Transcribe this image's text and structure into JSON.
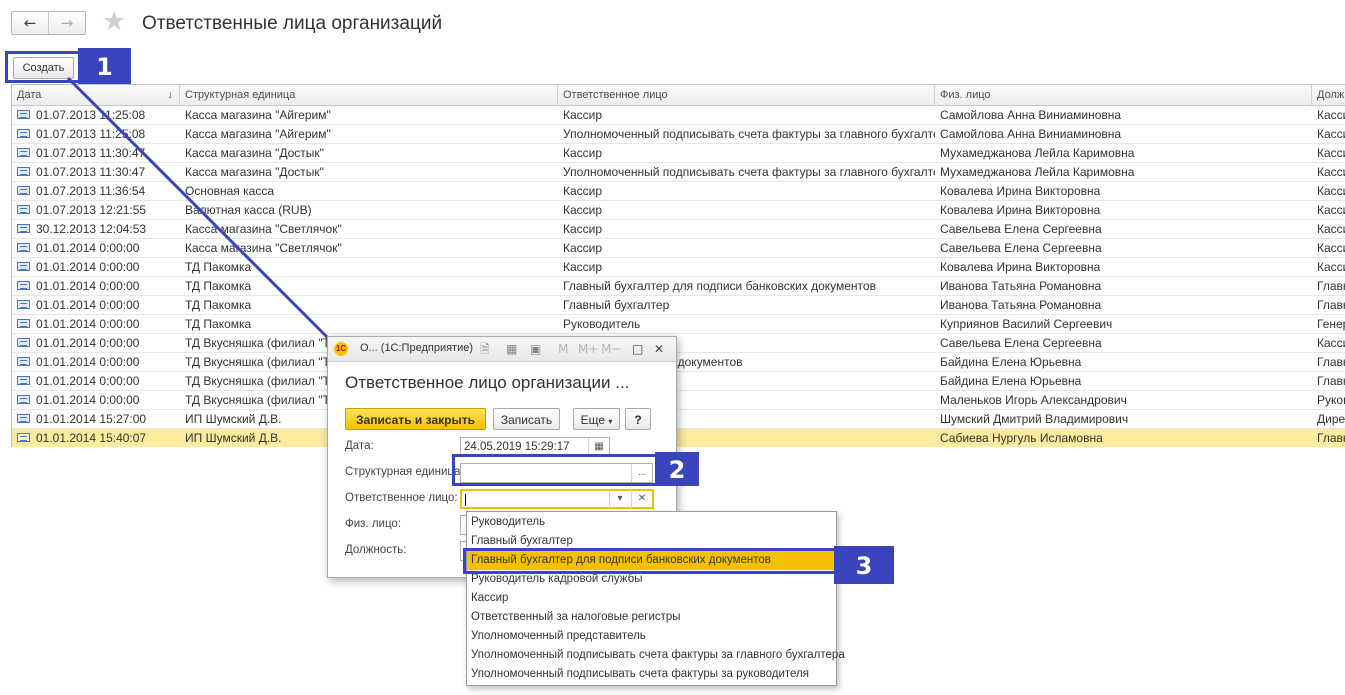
{
  "header": {
    "back_icon": "arrow-left-icon",
    "forward_icon": "arrow-right-icon",
    "favorite_icon": "star-icon",
    "title": "Ответственные лица организаций"
  },
  "toolbar": {
    "create_label": "Создать"
  },
  "callouts": {
    "c1": "1",
    "c2": "2",
    "c3": "3",
    "color": "#3a44bd"
  },
  "table": {
    "columns": [
      "Дата",
      "Структурная единица",
      "Ответственное лицо",
      "Физ. лицо",
      "Долж"
    ],
    "sort_icon": "↓",
    "rows": [
      {
        "date": "01.07.2013 11:25:08",
        "unit": "Касса магазина \"Айгерим\"",
        "role": "Кассир",
        "person": "Самойлова Анна Виниаминовна",
        "pos": "Касси"
      },
      {
        "date": "01.07.2013 11:25:08",
        "unit": "Касса магазина \"Айгерим\"",
        "role": "Уполномоченный подписывать счета фактуры за главного бухгалтера",
        "person": "Самойлова Анна Виниаминовна",
        "pos": "Касси"
      },
      {
        "date": "01.07.2013 11:30:47",
        "unit": "Касса магазина \"Достык\"",
        "role": "Кассир",
        "person": "Мухамеджанова Лейла Каримовна",
        "pos": "Касси"
      },
      {
        "date": "01.07.2013 11:30:47",
        "unit": "Касса магазина \"Достык\"",
        "role": "Уполномоченный подписывать счета фактуры за главного бухгалтера",
        "person": "Мухамеджанова Лейла Каримовна",
        "pos": "Касси"
      },
      {
        "date": "01.07.2013 11:36:54",
        "unit": "Основная касса",
        "role": "Кассир",
        "person": "Ковалева Ирина Викторовна",
        "pos": "Касси"
      },
      {
        "date": "01.07.2013 12:21:55",
        "unit": "Валютная касса (RUB)",
        "role": "Кассир",
        "person": "Ковалева Ирина Викторовна",
        "pos": "Касси"
      },
      {
        "date": "30.12.2013 12:04:53",
        "unit": "Касса магазина \"Светлячок\"",
        "role": "Кассир",
        "person": "Савельева Елена Сергеевна",
        "pos": "Касси"
      },
      {
        "date": "01.01.2014 0:00:00",
        "unit": "Касса магазина \"Светлячок\"",
        "role": "Кассир",
        "person": "Савельева Елена Сергеевна",
        "pos": "Касси"
      },
      {
        "date": "01.01.2014 0:00:00",
        "unit": "ТД Пакомка",
        "role": "Кассир",
        "person": "Ковалева Ирина Викторовна",
        "pos": "Касси"
      },
      {
        "date": "01.01.2014 0:00:00",
        "unit": "ТД Пакомка",
        "role": "Главный бухгалтер для подписи банковских документов",
        "person": "Иванова Татьяна Романовна",
        "pos": "Главн"
      },
      {
        "date": "01.01.2014 0:00:00",
        "unit": "ТД Пакомка",
        "role": "Главный бухгалтер",
        "person": "Иванова Татьяна Романовна",
        "pos": "Главн"
      },
      {
        "date": "01.01.2014 0:00:00",
        "unit": "ТД Пакомка",
        "role": "Руководитель",
        "person": "Куприянов Василий Сергеевич",
        "pos": "Генер"
      },
      {
        "date": "01.01.2014 0:00:00",
        "unit": "ТД Вкусняшка (филиал \"ТД",
        "role": "",
        "person": "Савельева Елена Сергеевна",
        "pos": "Касси"
      },
      {
        "date": "01.01.2014 0:00:00",
        "unit": "ТД Вкусняшка (филиал \"ТД",
        "role": "подписи банковских документов",
        "person": "Байдина Елена Юрьевна",
        "pos": "Главн"
      },
      {
        "date": "01.01.2014 0:00:00",
        "unit": "ТД Вкусняшка (филиал \"ТД",
        "role": "",
        "person": "Байдина Елена Юрьевна",
        "pos": "Главн"
      },
      {
        "date": "01.01.2014 0:00:00",
        "unit": "ТД Вкусняшка (филиал \"ТД",
        "role": "",
        "person": "Маленьков Игорь Александрович",
        "pos": "Руков"
      },
      {
        "date": "01.01.2014 15:27:00",
        "unit": "ИП Шумский Д.В.",
        "role": "",
        "person": "Шумский Дмитрий Владимирович",
        "pos": "Дирек"
      },
      {
        "date": "01.01.2014 15:40:07",
        "unit": "ИП Шумский Д.В.",
        "role": "",
        "person": "Сабиева Нургуль Исламовна",
        "pos": "Главн"
      }
    ]
  },
  "modal": {
    "window_title": "О...  (1С:Предприятие)",
    "heading": "Ответственное лицо организации ...",
    "save_close_label": "Записать и закрыть",
    "save_label": "Записать",
    "more_label": "Еще",
    "help_label": "?",
    "date_label": "Дата:",
    "date_value": "24.05.2019 15:29:17",
    "unit_label": "Структурная единица:",
    "unit_value": "",
    "role_label": "Ответственное лицо:",
    "role_value": "",
    "person_label": "Физ. лицо:",
    "position_label": "Должность:",
    "toolbar_icons": [
      "doc-icon",
      "calc-icon",
      "calendar-icon",
      "M",
      "M+",
      "M−"
    ]
  },
  "dropdown": {
    "selected_index": 2,
    "items": [
      "Руководитель",
      "Главный бухгалтер",
      "Главный бухгалтер для подписи банковских документов",
      "Руководитель кадровой службы",
      "Кассир",
      "Ответственный за налоговые регистры",
      "Уполномоченный представитель",
      "Уполномоченный подписывать счета фактуры за главного бухгалтера",
      "Уполномоченный подписывать счета фактуры за руководителя"
    ]
  }
}
